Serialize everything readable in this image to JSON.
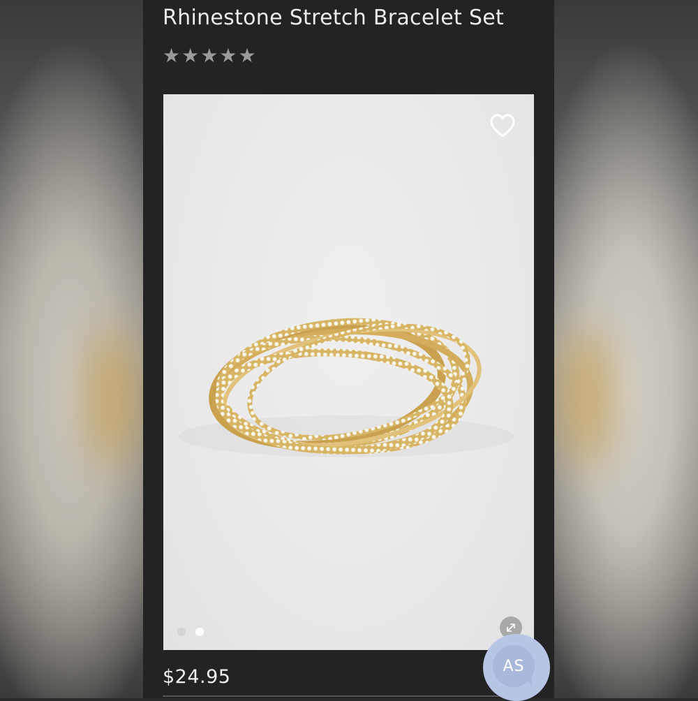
{
  "product": {
    "title": "Rhinestone Stretch Bracelet Set",
    "rating": {
      "stars_filled": 0,
      "stars_total": 5
    },
    "price": "$24.95"
  },
  "gallery": {
    "image_count": 2,
    "active_index": 1
  },
  "chat_widget": {
    "initials": "AS"
  },
  "icons": {
    "favorite": "heart-outline-icon",
    "expand": "expand-arrows-icon",
    "rating": "star-icon"
  },
  "colors": {
    "screen_bg": "#232323",
    "title_text": "#ececec",
    "star": "#9b9b9b",
    "photo_bg": "#e9e9e9",
    "chat_bubble": "#a8b9dc",
    "gold": "#d6b46a"
  }
}
